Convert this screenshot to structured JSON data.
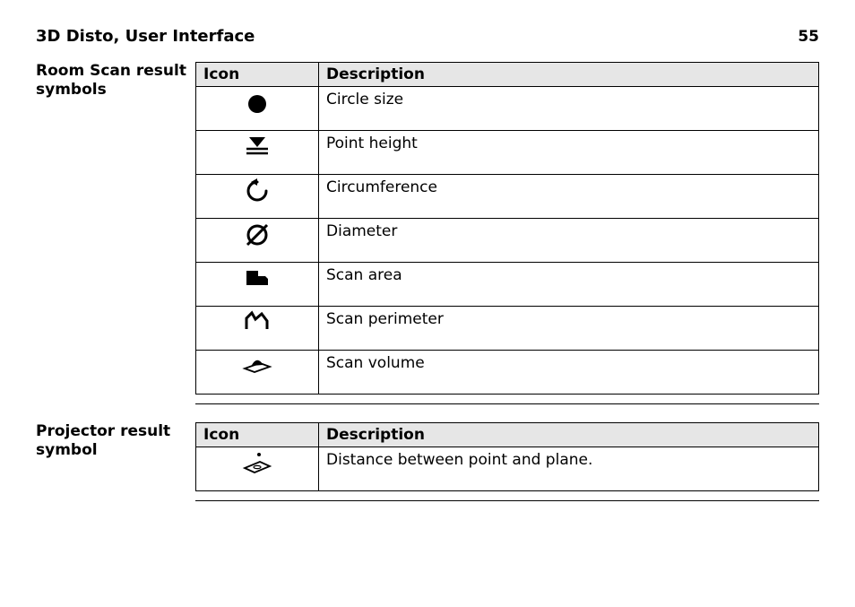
{
  "header": {
    "title": "3D Disto, User Interface",
    "page_number": "55"
  },
  "sections": [
    {
      "label": "Room Scan result symbols",
      "columns": {
        "icon": "Icon",
        "desc": "Description"
      },
      "rows": [
        {
          "icon": "circle-size-icon",
          "desc": "Circle size"
        },
        {
          "icon": "point-height-icon",
          "desc": "Point height"
        },
        {
          "icon": "circumference-icon",
          "desc": "Circumference"
        },
        {
          "icon": "diameter-icon",
          "desc": "Diameter"
        },
        {
          "icon": "scan-area-icon",
          "desc": "Scan area"
        },
        {
          "icon": "scan-perimeter-icon",
          "desc": "Scan perimeter"
        },
        {
          "icon": "scan-volume-icon",
          "desc": "Scan volume"
        }
      ]
    },
    {
      "label": "Projector result symbol",
      "columns": {
        "icon": "Icon",
        "desc": "Description"
      },
      "rows": [
        {
          "icon": "distance-point-plane-icon",
          "desc": "Distance between point and plane."
        }
      ]
    }
  ]
}
